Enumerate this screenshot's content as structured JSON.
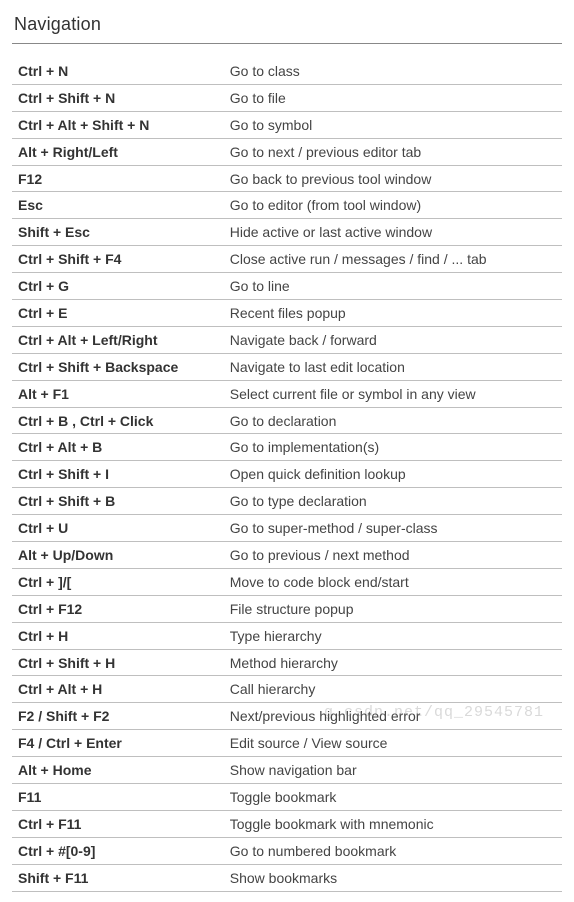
{
  "section_title": "Navigation",
  "shortcuts": [
    {
      "key": "Ctrl + N",
      "desc": "Go to class"
    },
    {
      "key": "Ctrl + Shift + N",
      "desc": "Go to file"
    },
    {
      "key": "Ctrl + Alt + Shift + N",
      "desc": "Go to symbol"
    },
    {
      "key": "Alt + Right/Left",
      "desc": "Go to next / previous editor tab"
    },
    {
      "key": "F12",
      "desc": "Go back to previous tool window"
    },
    {
      "key": "Esc",
      "desc": "Go to editor (from tool window)"
    },
    {
      "key": "Shift + Esc",
      "desc": "Hide active or last active window"
    },
    {
      "key": "Ctrl + Shift + F4",
      "desc": "Close active run / messages / find / ... tab"
    },
    {
      "key": "Ctrl + G",
      "desc": "Go to line"
    },
    {
      "key": "Ctrl + E",
      "desc": "Recent files popup"
    },
    {
      "key": "Ctrl + Alt + Left/Right",
      "desc": "Navigate back / forward"
    },
    {
      "key": "Ctrl + Shift + Backspace",
      "desc": "Navigate to last edit location"
    },
    {
      "key": "Alt + F1",
      "desc": "Select current file or symbol in any view"
    },
    {
      "key": "Ctrl + B , Ctrl + Click",
      "desc": "Go to declaration"
    },
    {
      "key": "Ctrl + Alt + B",
      "desc": "Go to implementation(s)"
    },
    {
      "key": "Ctrl + Shift + I",
      "desc": "Open quick definition lookup"
    },
    {
      "key": "Ctrl + Shift + B",
      "desc": "Go to type declaration"
    },
    {
      "key": "Ctrl + U",
      "desc": "Go to super-method / super-class"
    },
    {
      "key": "Alt + Up/Down",
      "desc": "Go to previous / next method"
    },
    {
      "key": "Ctrl + ]/[",
      "desc": "Move to code block end/start"
    },
    {
      "key": "Ctrl + F12",
      "desc": "File structure popup"
    },
    {
      "key": "Ctrl + H",
      "desc": "Type hierarchy"
    },
    {
      "key": "Ctrl + Shift + H",
      "desc": "Method hierarchy"
    },
    {
      "key": "Ctrl + Alt + H",
      "desc": "Call hierarchy"
    },
    {
      "key": "F2 / Shift + F2",
      "desc": "Next/previous highlighted error"
    },
    {
      "key": "F4 / Ctrl + Enter",
      "desc": "Edit source / View source"
    },
    {
      "key": "Alt + Home",
      "desc": "Show navigation bar"
    },
    {
      "key": "F11",
      "desc": "Toggle bookmark"
    },
    {
      "key": "Ctrl + F11",
      "desc": "Toggle bookmark with mnemonic"
    },
    {
      "key": "Ctrl + #[0-9]",
      "desc": "Go to numbered bookmark"
    },
    {
      "key": "Shift + F11",
      "desc": "Show bookmarks"
    }
  ],
  "watermark": "g.csdn.net/qq_29545781"
}
